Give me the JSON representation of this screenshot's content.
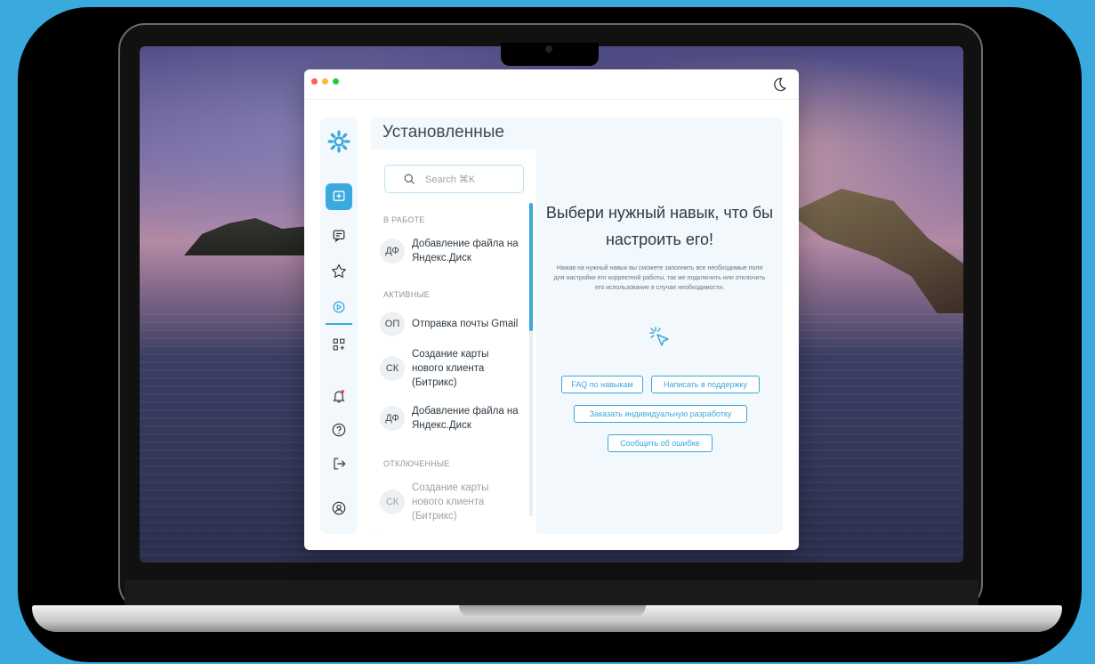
{
  "panel": {
    "title": "Установленные",
    "search_placeholder": "Search ⌘K"
  },
  "sections": {
    "working": "В РАБОТЕ",
    "active": "АКТИВНЫЕ",
    "disabled": "ОТКЛЮЧЕННЫЕ"
  },
  "items": [
    {
      "initials": "ДФ",
      "label": "Добавление файла на Яндекс.Диск",
      "section": "working"
    },
    {
      "initials": "ОП",
      "label": "Отправка почты Gmail",
      "section": "active"
    },
    {
      "initials": "СК",
      "label": "Создание карты нового клиента (Битрикс)",
      "section": "active"
    },
    {
      "initials": "ДФ",
      "label": "Добавление файла на Яндекс.Диск",
      "section": "active"
    },
    {
      "initials": "СК",
      "label": "Создание карты нового клиента (Битрикс)",
      "section": "disabled"
    }
  ],
  "detail": {
    "title": "Выбери нужный навык, что бы настроить его!",
    "description": "Нажав на нужный навык вы сможете заполнить все необходимые поля для настройки его корректной работы, так же подключить или отключить его использование в случае необходимости.",
    "buttons": {
      "faq": "FAQ по навыкам",
      "support": "Написать в поддержку",
      "custom": "Заказать индивидуальную разработку",
      "report": "Сообщить об ошибке"
    }
  },
  "sidebar_icons": [
    "settings-gear-icon",
    "chat-plus-icon",
    "message-icon",
    "star-icon",
    "skills-icon",
    "add-app-icon",
    "notification-icon",
    "help-icon",
    "logout-icon",
    "profile-icon"
  ],
  "colors": {
    "accent": "#3aa9dd",
    "background": "#3aa9dd",
    "panel_bg": "#f2f8fb"
  }
}
